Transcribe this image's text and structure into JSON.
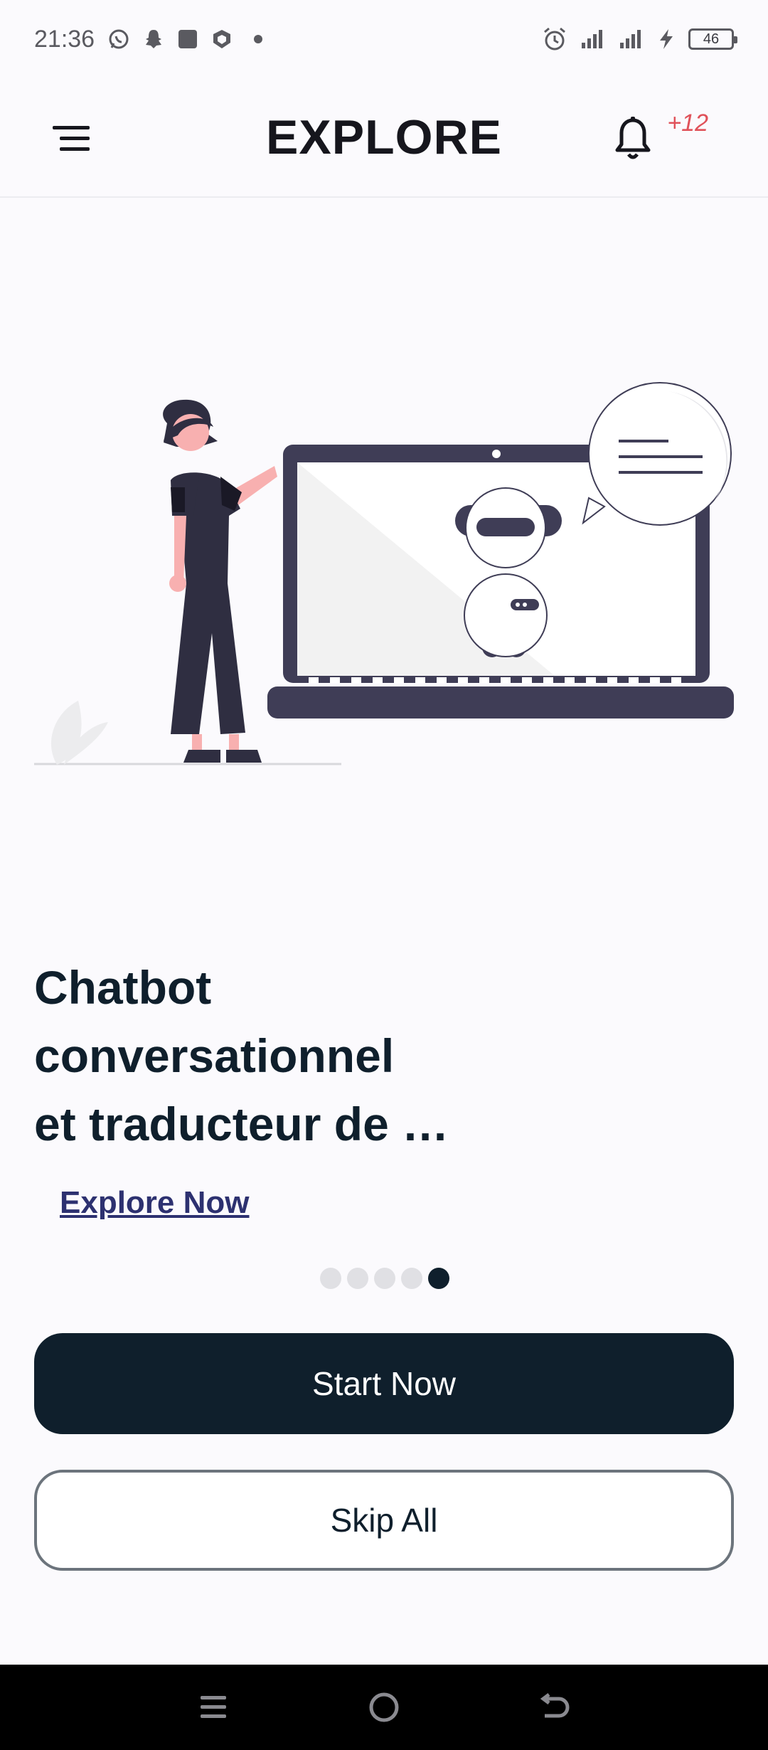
{
  "status_bar": {
    "time": "21:36",
    "left_icons": [
      "whatsapp-icon",
      "snapchat-icon",
      "app-square-icon",
      "shield-icon"
    ],
    "right_icons": [
      "alarm-icon",
      "signal-icon",
      "signal-icon",
      "charging-icon"
    ],
    "battery_level": "46"
  },
  "app_bar": {
    "title": "EXPLORE",
    "notification_count": "+12",
    "menu_icon": "menu-icon",
    "bell_icon": "bell-icon"
  },
  "slide": {
    "title_lines": [
      "Chatbot",
      "conversationnel",
      "et traducteur de …"
    ],
    "link_label": "Explore Now",
    "illustration": "woman-presenting-chatbot-on-laptop"
  },
  "pager": {
    "total": 5,
    "active_index": 4
  },
  "actions": {
    "primary_label": "Start Now",
    "secondary_label": "Skip All"
  },
  "nav_bar": {
    "buttons": [
      "recents-icon",
      "home-icon",
      "back-icon"
    ]
  },
  "colors": {
    "primary": "#0f1f2c",
    "link": "#2d3170",
    "badge": "#e0525a",
    "background": "#fbfafd"
  }
}
